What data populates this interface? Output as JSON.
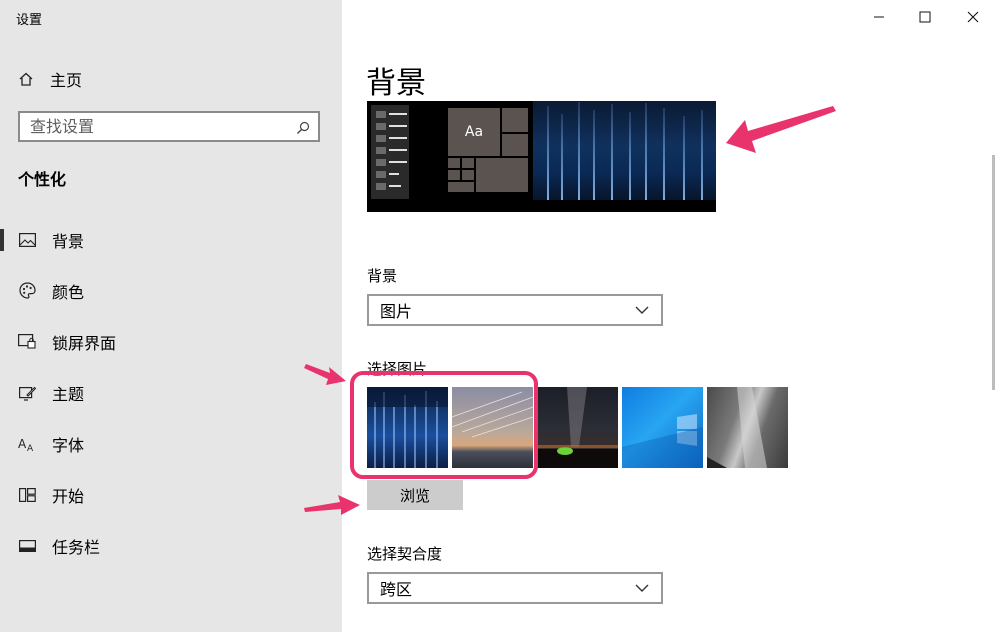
{
  "window": {
    "title": "设置",
    "minimize_glyph": "—",
    "maximize_glyph": "☐",
    "close_glyph": "✕"
  },
  "sidebar": {
    "home_label": "主页",
    "search_placeholder": "查找设置",
    "section_title": "个性化",
    "items": [
      {
        "label": "背景",
        "icon": "picture-icon",
        "active": true
      },
      {
        "label": "颜色",
        "icon": "palette-icon",
        "active": false
      },
      {
        "label": "锁屏界面",
        "icon": "lock-screen-icon",
        "active": false
      },
      {
        "label": "主题",
        "icon": "theme-icon",
        "active": false
      },
      {
        "label": "字体",
        "icon": "font-icon",
        "active": false
      },
      {
        "label": "开始",
        "icon": "start-icon",
        "active": false
      },
      {
        "label": "任务栏",
        "icon": "taskbar-icon",
        "active": false
      }
    ]
  },
  "main": {
    "page_title": "背景",
    "preview": {
      "tile_text": "Aa"
    },
    "background_label": "背景",
    "background_value": "图片",
    "choose_picture_label": "选择图片",
    "browse_label": "浏览",
    "fit_label": "选择契合度",
    "fit_value": "跨区"
  },
  "colors": {
    "annotation": "#e8336d",
    "sidebar_bg": "#e6e6e6"
  }
}
